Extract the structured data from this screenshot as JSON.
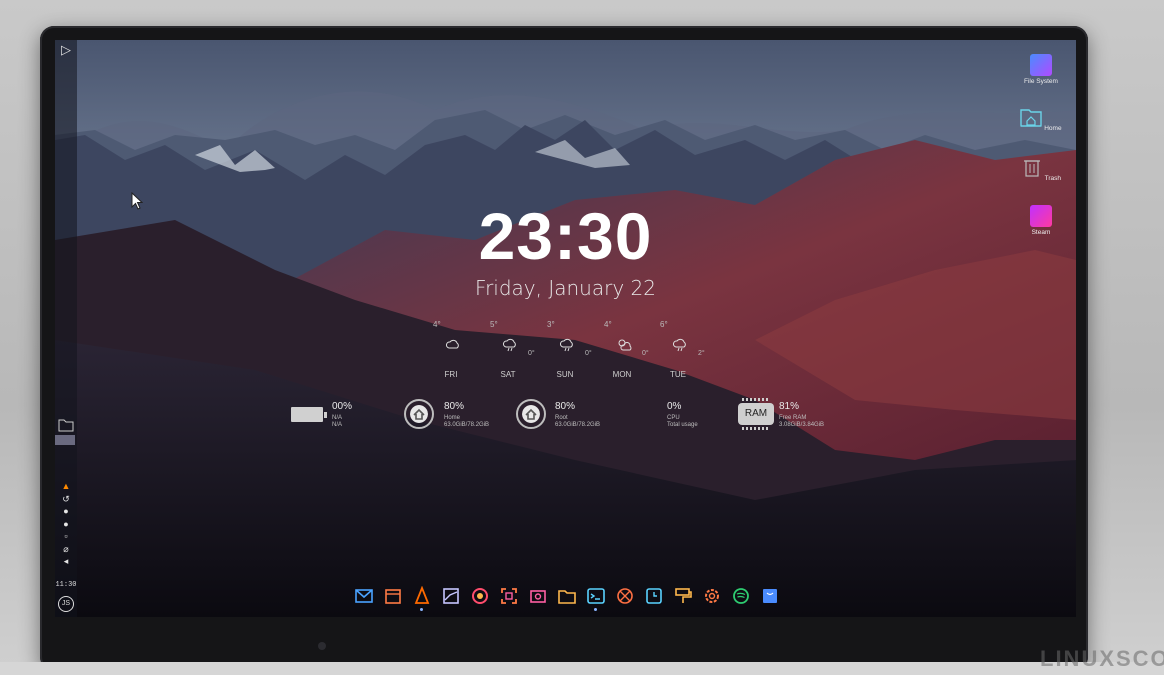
{
  "clock": {
    "time": "23:30",
    "date": "Friday, January 22"
  },
  "weather": [
    {
      "day": "FRI",
      "high": "4°",
      "low": "",
      "icon": "cloud-icon"
    },
    {
      "day": "SAT",
      "high": "5°",
      "low": "0°",
      "icon": "cloud-rain-icon"
    },
    {
      "day": "SUN",
      "high": "3°",
      "low": "0°",
      "icon": "cloud-rain-icon"
    },
    {
      "day": "MON",
      "high": "4°",
      "low": "0°",
      "icon": "sun-cloud-icon"
    },
    {
      "day": "TUE",
      "high": "6°",
      "low": "2°",
      "icon": "cloud-rain-icon"
    }
  ],
  "stats": {
    "battery": {
      "percent": "00%",
      "line1": "N/A",
      "line2": "N/A"
    },
    "home": {
      "percent": "80%",
      "name": "Home",
      "usage": "63.0GiB/78.2GiB"
    },
    "root": {
      "percent": "80%",
      "name": "Root",
      "usage": "63.0GiB/78.2GiB"
    },
    "cpu": {
      "percent": "0%",
      "name": "CPU",
      "usage": "Total usage"
    },
    "ram": {
      "label": "RAM",
      "percent": "81%",
      "name": "Free RAM",
      "usage": "3.08GiB/3.84GiB"
    }
  },
  "desktop_icons": [
    {
      "label": "File System",
      "icon": "file-system-icon"
    },
    {
      "label": "Home",
      "icon": "home-folder-icon"
    },
    {
      "label": "Trash",
      "icon": "trash-icon"
    },
    {
      "label": "Steam",
      "icon": "steam-icon"
    }
  ],
  "sidebar": {
    "clock": "11:30"
  },
  "dock": [
    {
      "name": "mail-icon",
      "color": "#4aa3ff"
    },
    {
      "name": "calendar-icon",
      "color": "#ff7a45"
    },
    {
      "name": "vlc-icon",
      "color": "#ff6a00"
    },
    {
      "name": "image-viewer-icon",
      "color": "#c6c6ff"
    },
    {
      "name": "firefox-icon",
      "color": "#ff4d6d"
    },
    {
      "name": "screenshot-icon",
      "color": "#ff7a45"
    },
    {
      "name": "photo-editor-icon",
      "color": "#ff5fa2"
    },
    {
      "name": "files-icon",
      "color": "#ffb84d"
    },
    {
      "name": "terminal-icon",
      "color": "#5ad3ff"
    },
    {
      "name": "system-monitor-icon",
      "color": "#ff7043"
    },
    {
      "name": "clock-app-icon",
      "color": "#5ad3ff"
    },
    {
      "name": "paint-icon",
      "color": "#ffb84d"
    },
    {
      "name": "settings-icon",
      "color": "#ff7a45"
    },
    {
      "name": "spotify-icon",
      "color": "#2ecc71"
    },
    {
      "name": "store-icon",
      "color": "#4a8cff"
    }
  ],
  "watermark": "LINUXSCO"
}
